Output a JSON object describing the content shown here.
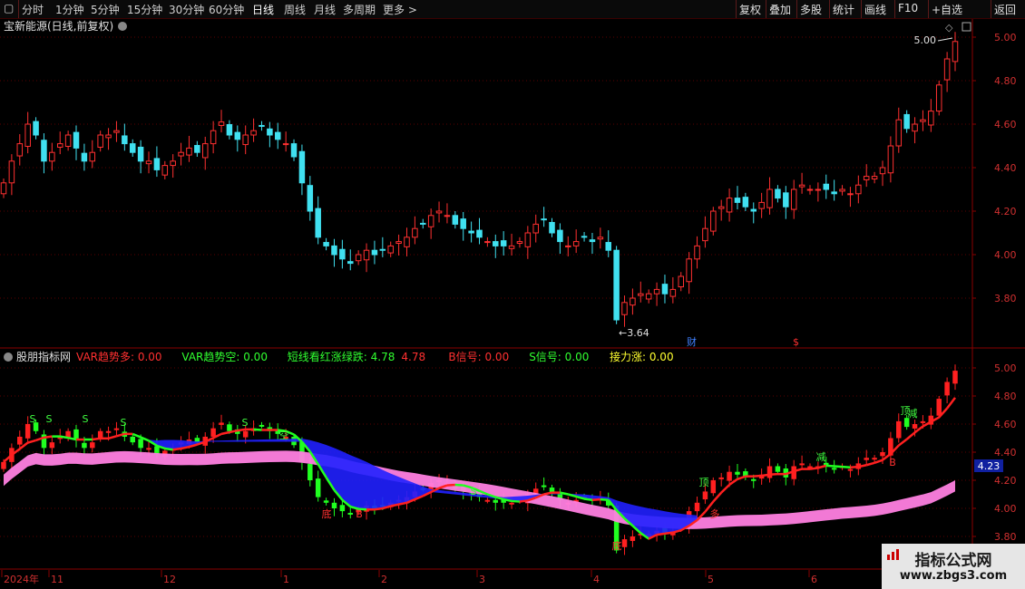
{
  "toolbar": {
    "left_tabs": [
      "分时",
      "1分钟",
      "5分钟",
      "15分钟",
      "30分钟",
      "60分钟",
      "日线",
      "周线",
      "月线",
      "多周期",
      "更多 >"
    ],
    "active_tab": "日线",
    "right_buttons": [
      "复权",
      "叠加",
      "多股",
      "统计",
      "画线",
      "F10",
      "+自选",
      "返回"
    ]
  },
  "main_panel": {
    "title": "宝新能源(日线,前复权)",
    "price_axis": [
      "5.00",
      "4.80",
      "4.60",
      "4.40",
      "4.20",
      "4.00",
      "3.80"
    ],
    "high_marker": "5.00",
    "low_marker": "3.64",
    "event_markers": [
      "财",
      "$"
    ]
  },
  "indicator_panel": {
    "name": "股朋指标网",
    "values": [
      {
        "label": "VAR趋势多:",
        "value": "0.00",
        "color": "#ff3030"
      },
      {
        "label": "VAR趋势空:",
        "value": "0.00",
        "color": "#30ff30"
      },
      {
        "label": "短线看红涨绿跌:",
        "value": "4.78",
        "color": "#30ff30"
      },
      {
        "label": "",
        "value": "4.78",
        "color": "#ff3030"
      },
      {
        "label": "B信号:",
        "value": "0.00",
        "color": "#ff3030"
      },
      {
        "label": "S信号:",
        "value": "0.00",
        "color": "#30ff30"
      },
      {
        "label": "接力涨:",
        "value": "0.00",
        "color": "#ffff30"
      }
    ],
    "price_axis": [
      "5.00",
      "4.80",
      "4.60",
      "4.40",
      "4.20",
      "4.00",
      "3.80"
    ],
    "current_value": "4.23",
    "signal_labels": [
      "S",
      "S",
      "S",
      "S",
      "S",
      "空",
      "底",
      "B",
      "S",
      "底",
      "顶",
      "多",
      "减",
      "顶",
      "减",
      "B"
    ]
  },
  "time_axis": [
    "2024年",
    "11",
    "12",
    "1",
    "2",
    "3",
    "4",
    "5",
    "6"
  ],
  "colors": {
    "up": "#ff3030",
    "down": "#40e0f0",
    "ind_up": "#ff2020",
    "ind_down": "#20ff20",
    "band": "#ff80e0",
    "blue": "#2020ff"
  },
  "watermark": {
    "title": "指标公式网",
    "url": "www.zbgs3.com"
  },
  "chart_data": {
    "type": "candlestick",
    "daily_close": [
      4.33,
      4.43,
      4.51,
      4.6,
      4.55,
      4.43,
      4.47,
      4.51,
      4.55,
      4.49,
      4.43,
      4.47,
      4.55,
      4.55,
      4.57,
      4.51,
      4.47,
      4.43,
      4.43,
      4.39,
      4.41,
      4.43,
      4.47,
      4.49,
      4.47,
      4.51,
      4.57,
      4.61,
      4.55,
      4.53,
      4.55,
      4.57,
      4.59,
      4.55,
      4.53,
      4.51,
      4.45,
      4.33,
      4.2,
      4.08,
      4.04,
      4,
      3.98,
      3.96,
      4,
      4.02,
      4,
      4.02,
      4.04,
      4.06,
      4.08,
      4.12,
      4.14,
      4.18,
      4.2,
      4.18,
      4.14,
      4.12,
      4.1,
      4.08,
      4.06,
      4.04,
      4.04,
      4.04,
      4.06,
      4.1,
      4.14,
      4.16,
      4.1,
      4.06,
      4.04,
      4.06,
      4.08,
      4.06,
      4.08,
      4.02,
      3.7,
      3.78,
      3.8,
      3.82,
      3.82,
      3.84,
      3.82,
      3.84,
      3.9,
      3.98,
      4.04,
      4.12,
      4.2,
      4.22,
      4.26,
      4.24,
      4.22,
      4.2,
      4.24,
      4.3,
      4.26,
      4.22,
      4.3,
      4.32,
      4.3,
      4.3,
      4.3,
      4.28,
      4.3,
      4.28,
      4.32,
      4.36,
      4.36,
      4.4,
      4.5,
      4.62,
      4.58,
      4.6,
      4.62,
      4.66,
      4.78,
      4.9,
      4.98
    ],
    "ylim": [
      3.64,
      5.0
    ],
    "high": 5.0,
    "low": 3.64
  }
}
